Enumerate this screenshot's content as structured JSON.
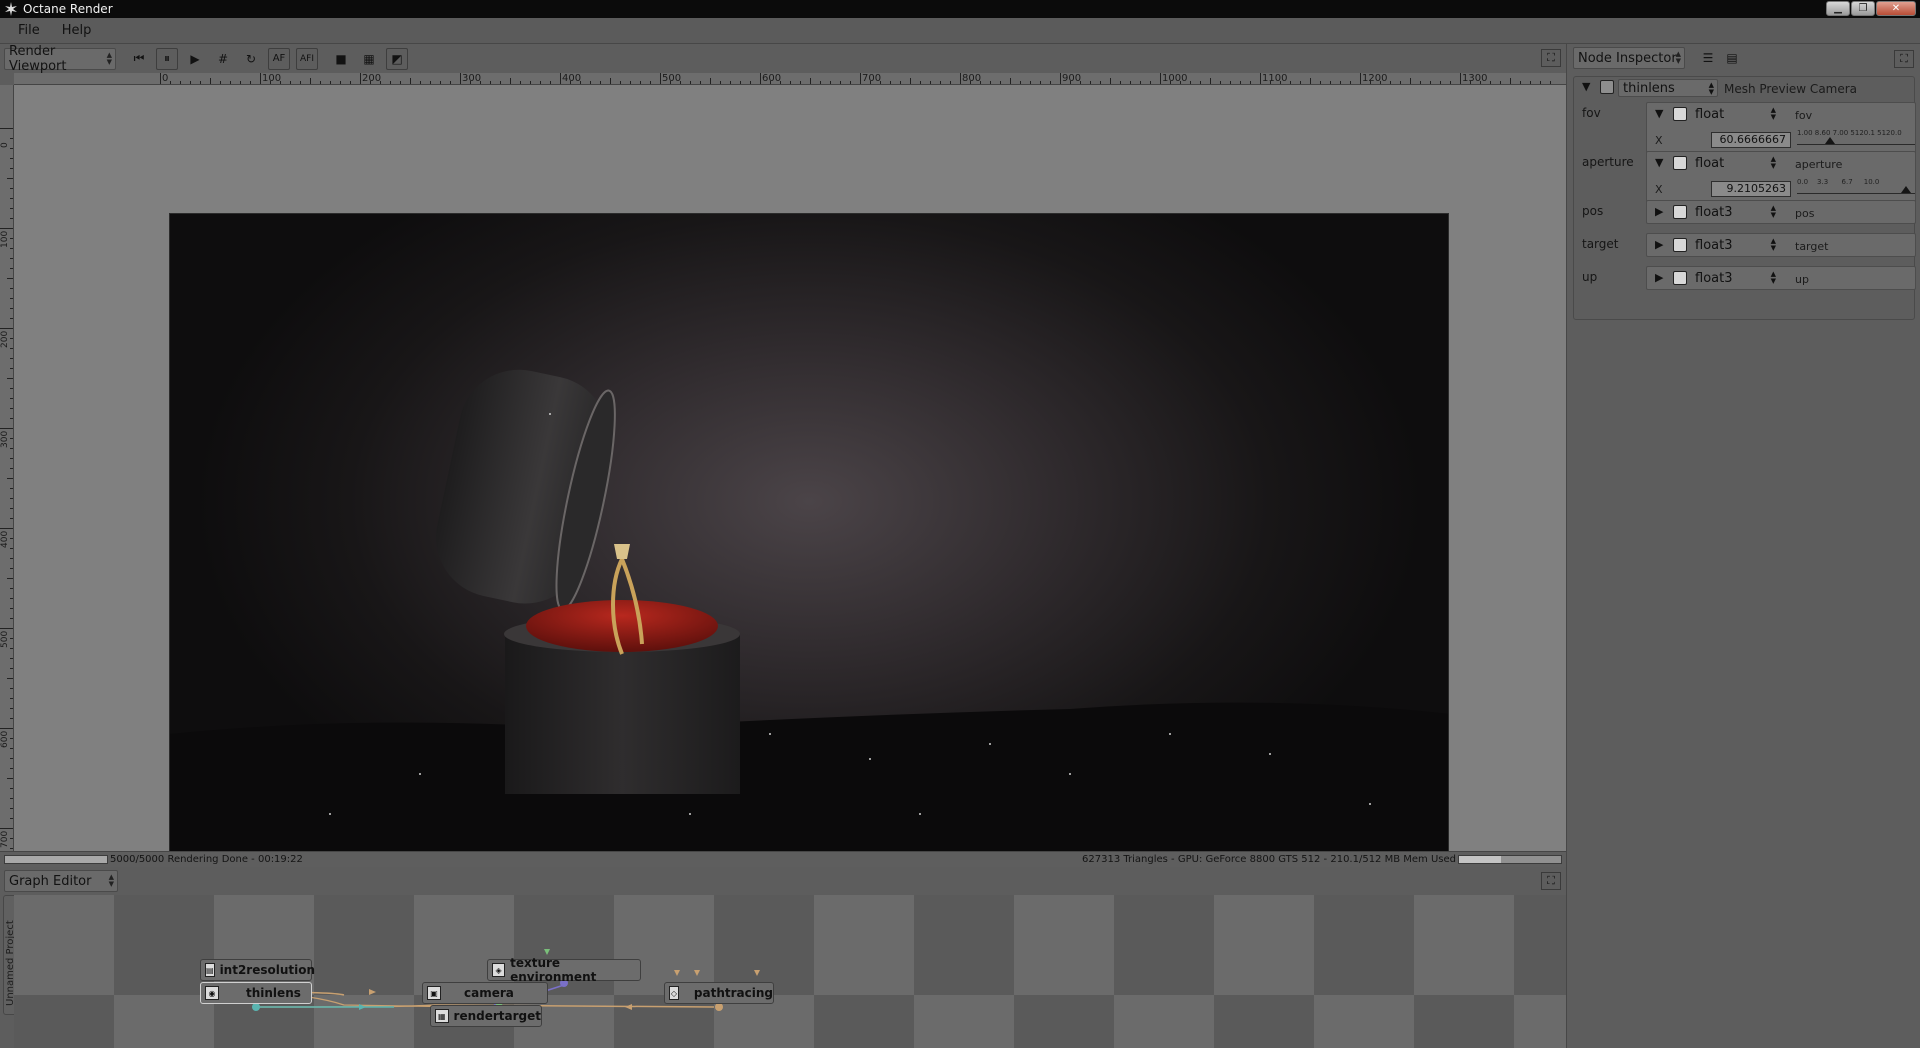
{
  "window": {
    "title": "Octane Render",
    "minimize": "▁",
    "restore": "❐",
    "close": "✕"
  },
  "menu": {
    "file": "File",
    "help": "Help"
  },
  "toolbar": {
    "viewport_select": "Render Viewport",
    "btn_rewind": "⏮",
    "btn_pause": "⏸",
    "btn_play": "▶",
    "btn_grid": "#",
    "btn_refresh": "↻",
    "btn_af": "AF",
    "btn_afi": "AFI",
    "btn_square": "■",
    "btn_checker": "▦",
    "btn_alpha": "◩",
    "max_icon": "⛶"
  },
  "ruler_h_labels": [
    "0",
    "100",
    "200",
    "300",
    "400",
    "500",
    "600",
    "700",
    "800",
    "900",
    "1000",
    "1100",
    "1200",
    "1300"
  ],
  "ruler_v_labels": [
    "0",
    "100",
    "200",
    "300",
    "400",
    "500",
    "600",
    "700"
  ],
  "status": {
    "left": "5000/5000 Rendering Done - 00:19:22",
    "right": "627313 Triangles - GPU: GeForce 8800 GTS 512 - 210.1/512 MB Mem Used",
    "render_progress": 1.0,
    "mem_progress": 0.41
  },
  "graph": {
    "title": "Graph Editor",
    "project_tab": "Unnamed Project",
    "nodes": {
      "int2resolution": "int2resolution",
      "thinlens": "thinlens",
      "camera": "camera",
      "texture_environment": "texture environment",
      "rendertarget": "rendertarget",
      "pathtracing": "pathtracing"
    }
  },
  "inspector": {
    "title": "Node Inspector",
    "node_type": "thinlens",
    "node_name": "Mesh Preview Camera",
    "props": [
      {
        "label": "fov",
        "type": "float",
        "name": "fov",
        "axis": "X",
        "value": "60.6666667",
        "ticks": "1.00 8.60 7.00 5120.1 5120.0",
        "slider_pos": 0.28
      },
      {
        "label": "aperture",
        "type": "float",
        "name": "aperture",
        "axis": "X",
        "value": "9.2105263",
        "ticks": "0.0    3.3      6.7     10.0",
        "slider_pos": 0.92
      },
      {
        "label": "pos",
        "type": "float3",
        "name": "pos"
      },
      {
        "label": "target",
        "type": "float3",
        "name": "target"
      },
      {
        "label": "up",
        "type": "float3",
        "name": "up"
      }
    ]
  },
  "colors": {
    "box_red": "#8a1a14",
    "gold": "#c9a25a",
    "wire_teal": "#5ab4b0",
    "wire_tan": "#c8a070",
    "wire_purple": "#7a70c8",
    "wire_green": "#7abf7a"
  }
}
